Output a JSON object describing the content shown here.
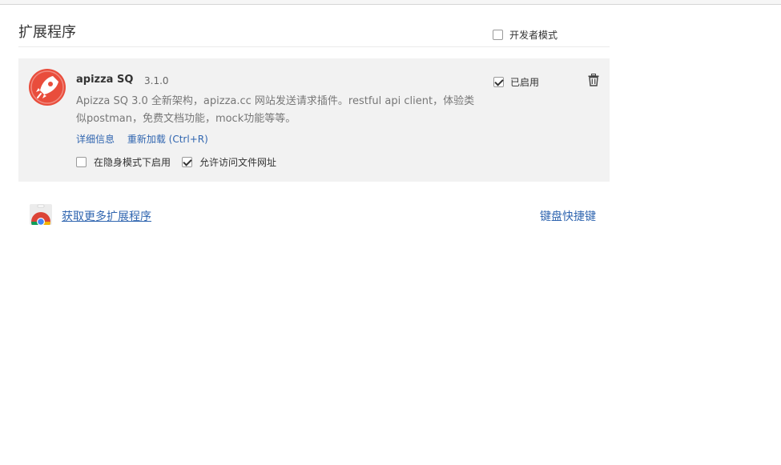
{
  "page": {
    "title": "扩展程序",
    "developer_mode_label": "开发者模式",
    "developer_mode_checked": false
  },
  "extension": {
    "name": "apizza SQ",
    "version": "3.1.0",
    "description": "Apizza SQ 3.0 全新架构，apizza.cc 网站发送请求插件。restful api client，体验类似postman，免费文档功能，mock功能等等。",
    "details_link": "详细信息",
    "reload_link": "重新加载 (Ctrl+R)",
    "incognito_label": "在隐身模式下启用",
    "incognito_checked": false,
    "file_access_label": "允许访问文件网址",
    "file_access_checked": true,
    "enabled_label": "已启用",
    "enabled_checked": true,
    "icon": "rocket-icon",
    "icon_color": "#e94d3c"
  },
  "footer": {
    "get_more_link": "获取更多扩展程序",
    "shortcuts_link": "键盘快捷键",
    "store_icon": "chrome-web-store-icon"
  },
  "colors": {
    "link": "#3166b0",
    "card_bg": "#f2f2f2"
  }
}
